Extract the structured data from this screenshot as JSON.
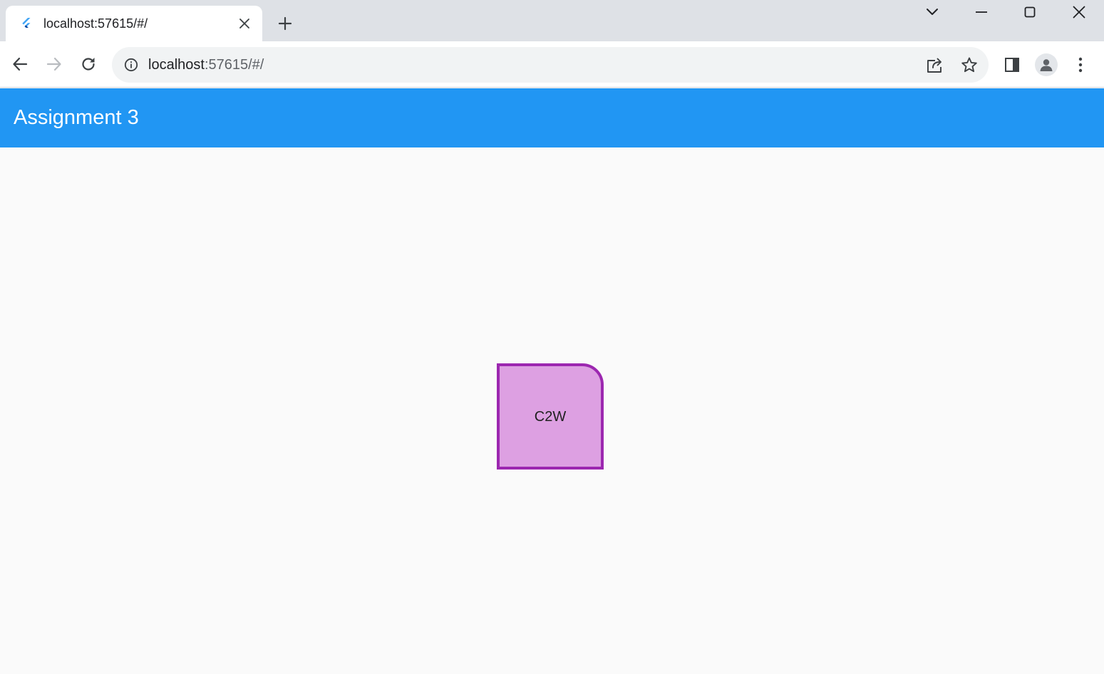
{
  "browser": {
    "tab": {
      "title": "localhost:57615/#/",
      "favicon": "flutter-icon"
    },
    "window_controls": [
      "tab-search-icon",
      "minimize-icon",
      "maximize-icon",
      "close-icon"
    ],
    "url": {
      "host": "localhost",
      "rest": ":57615/#/"
    },
    "toolbar_icons": [
      "back-icon",
      "forward-icon",
      "reload-icon",
      "info-icon",
      "share-icon",
      "star-icon",
      "side-panel-icon",
      "profile-icon",
      "more-menu-icon"
    ]
  },
  "app": {
    "title": "Assignment 3",
    "accent_color": "#2196f3",
    "card": {
      "label": "C2W",
      "fill_color": "#dda0e2",
      "border_color": "#9c27b0"
    }
  }
}
